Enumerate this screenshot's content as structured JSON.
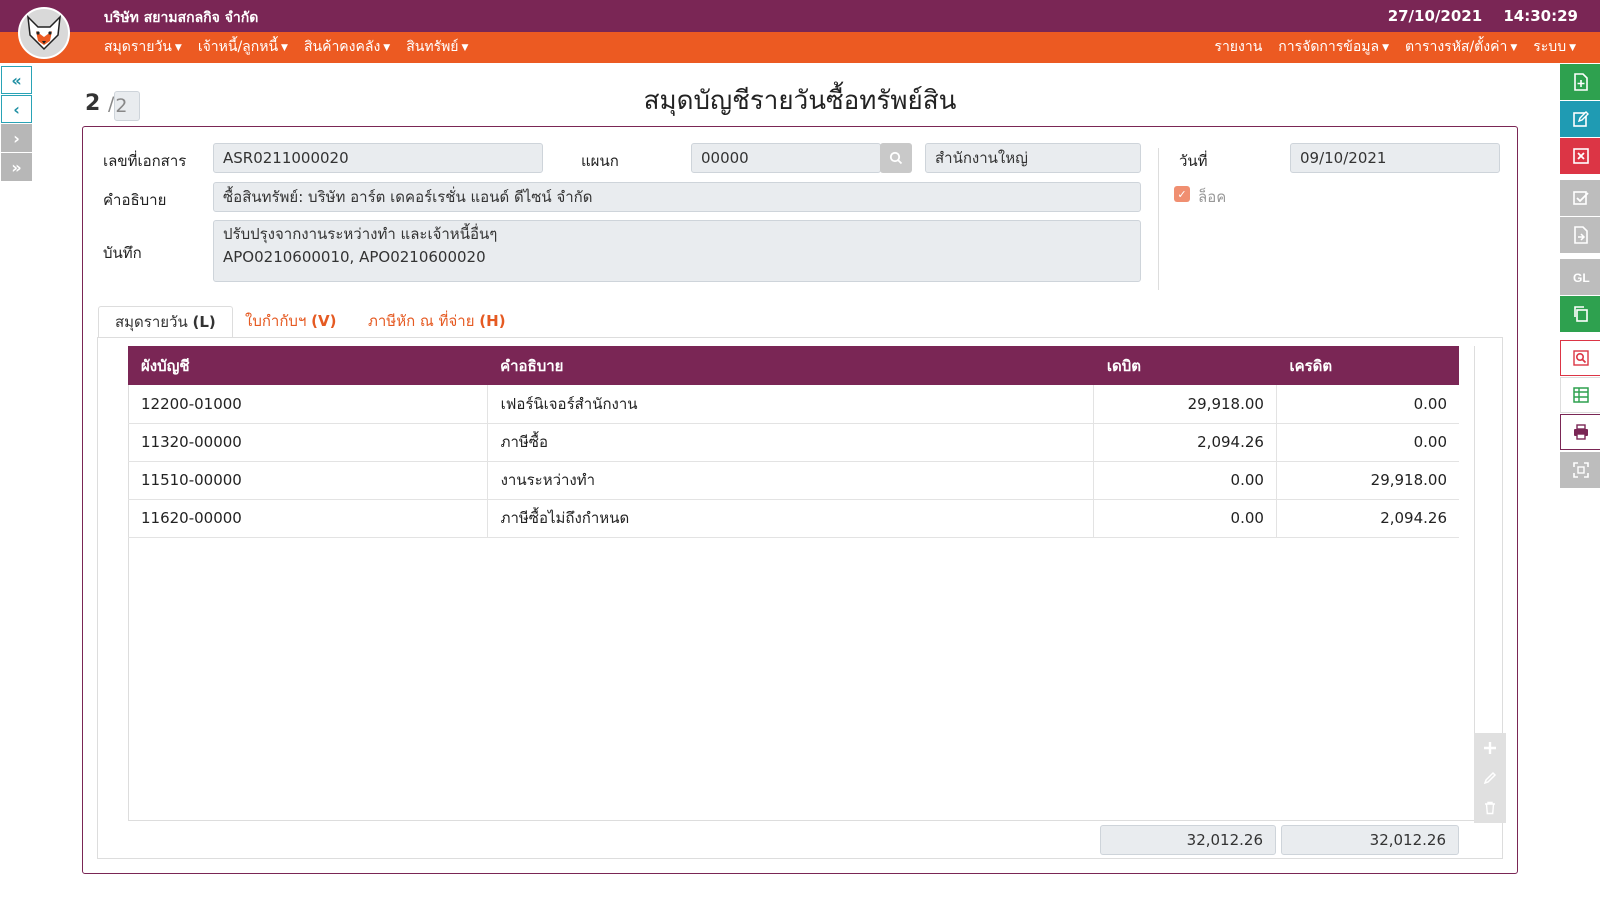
{
  "header": {
    "company": "บริษัท สยามสกลกิจ จำกัด",
    "date": "27/10/2021",
    "time": "14:30:29"
  },
  "menu_left": [
    "สมุดรายวัน",
    "เจ้าหนี้/ลูกหนี้",
    "สินค้าคงคลัง",
    "สินทรัพย์"
  ],
  "menu_right": [
    "รายงาน",
    "การจัดการข้อมูล",
    "ตารางรหัส/ตั้งค่า",
    "ระบบ"
  ],
  "pager": {
    "current": "2",
    "separator": "/",
    "total": "2"
  },
  "page_title": "สมุดบัญชีรายวันซื้อทรัพย์สิน",
  "form": {
    "doc_no_label": "เลขที่เอกสาร",
    "doc_no": "ASR0211000020",
    "dept_label": "แผนก",
    "dept_code": "00000",
    "dept_name": "สำนักงานใหญ่",
    "date_label": "วันที่",
    "date": "09/10/2021",
    "desc_label": "คำอธิบาย",
    "desc": "ซื้อสินทรัพย์: บริษัท อาร์ต เดคอร์เรชั่น แอนด์ ดีไซน์ จำกัด",
    "lock_label": "ล็อค",
    "note_label": "บันทึก",
    "note_line1": "ปรับปรุงจากงานระหว่างทำ และเจ้าหนี้อื่นๆ",
    "note_line2": "APO0210600010, APO0210600020"
  },
  "tabs": [
    {
      "label": "สมุดรายวัน",
      "key": "(L)"
    },
    {
      "label": "ใบกำกับฯ",
      "key": "(V)"
    },
    {
      "label": "ภาษีหัก ณ ที่จ่าย",
      "key": "(H)"
    }
  ],
  "table": {
    "headers": [
      "ผังบัญชี",
      "คำอธิบาย",
      "เดบิต",
      "เครดิต"
    ],
    "rows": [
      {
        "account": "12200-01000",
        "desc": "เฟอร์นิเจอร์สำนักงาน",
        "debit": "29,918.00",
        "credit": "0.00"
      },
      {
        "account": "11320-00000",
        "desc": "ภาษีซื้อ",
        "debit": "2,094.26",
        "credit": "0.00"
      },
      {
        "account": "11510-00000",
        "desc": "งานระหว่างทำ",
        "debit": "0.00",
        "credit": "29,918.00"
      },
      {
        "account": "11620-00000",
        "desc": "ภาษีซื้อไม่ถึงกำหนด",
        "debit": "0.00",
        "credit": "2,094.26"
      }
    ],
    "total_debit": "32,012.26",
    "total_credit": "32,012.26"
  },
  "colors": {
    "brand_purple": "#7a2655",
    "brand_orange": "#ec5a22",
    "action_green": "#2ea14f",
    "action_teal": "#1f9bb3",
    "action_red": "#dc3545"
  }
}
